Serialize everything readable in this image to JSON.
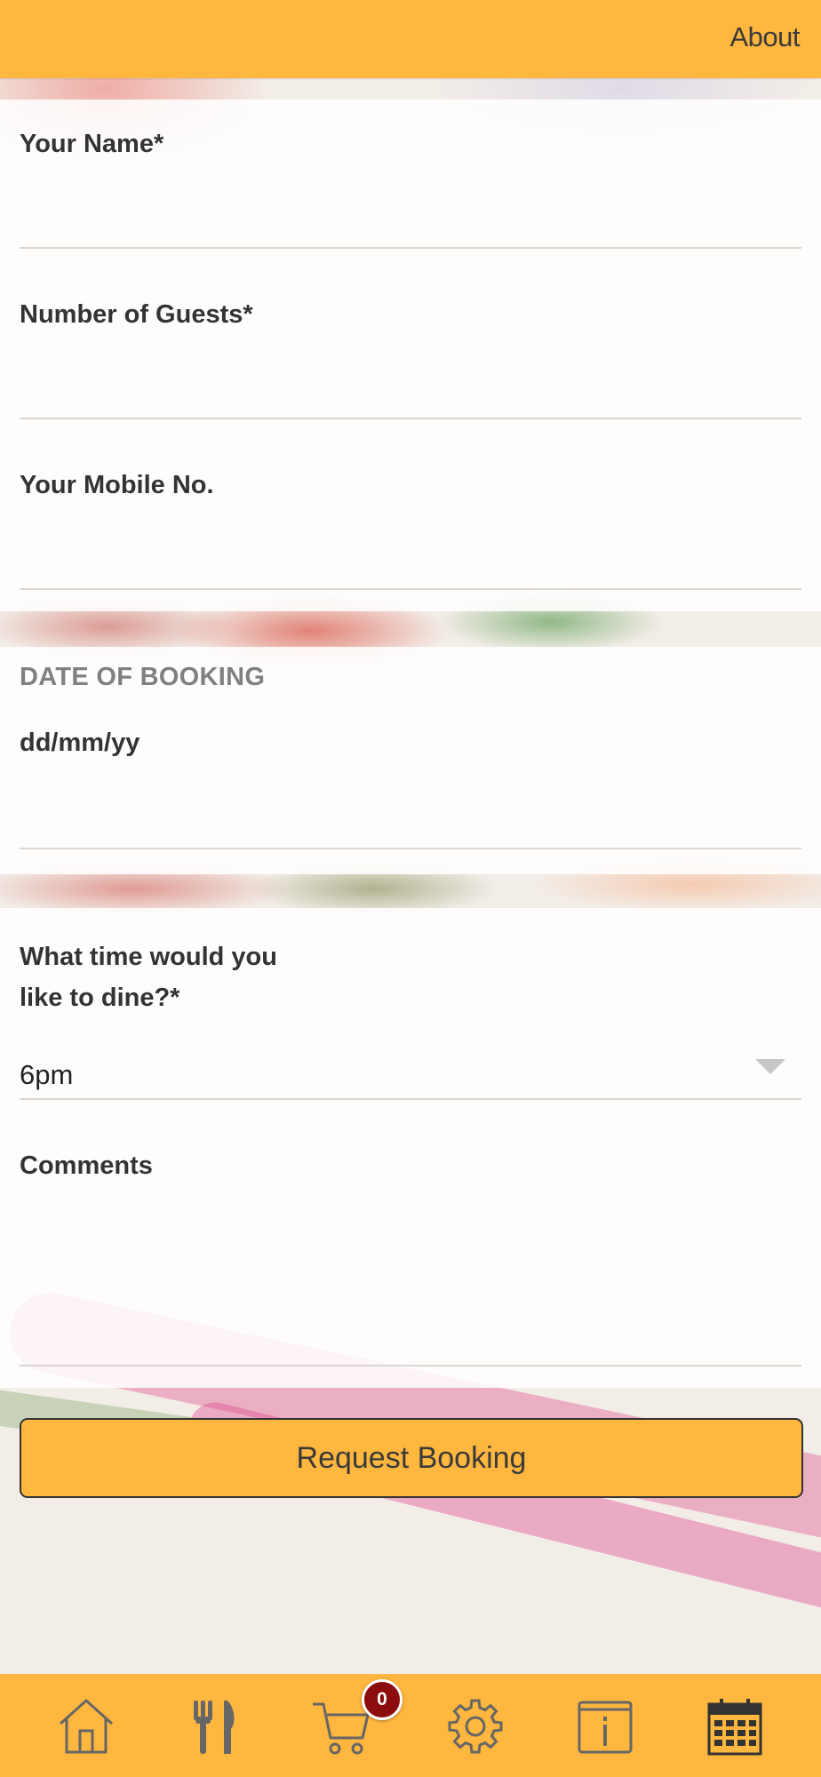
{
  "header": {
    "about_label": "About"
  },
  "form": {
    "name_label": "Your Name*",
    "guests_label": "Number of Guests*",
    "mobile_label": "Your Mobile No.",
    "date_section_title": "DATE OF BOOKING",
    "date_placeholder": "dd/mm/yy",
    "time_label_line1": "What time would you",
    "time_label_line2": "like to dine?*",
    "time_value": "6pm",
    "comments_label": "Comments",
    "submit_label": "Request Booking"
  },
  "tabbar": {
    "cart_count": "0",
    "items": [
      "home-icon",
      "utensils-icon",
      "cart-icon",
      "gear-icon",
      "info-icon",
      "calendar-icon"
    ]
  },
  "colors": {
    "accent": "#ffb73f",
    "badge": "#8c0d0d"
  }
}
